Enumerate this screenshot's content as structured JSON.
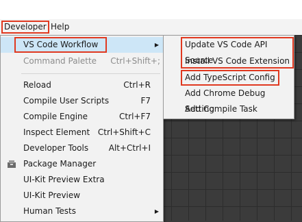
{
  "menubar": {
    "items": [
      {
        "label": "Developer"
      },
      {
        "label": "Help"
      }
    ]
  },
  "main_menu": {
    "vs_code_workflow": "VS Code Workflow",
    "command_palette": {
      "label": "Command Palette",
      "shortcut": "Ctrl+Shift+;"
    },
    "reload": {
      "label": "Reload",
      "shortcut": "Ctrl+R"
    },
    "compile_user_scripts": {
      "label": "Compile User Scripts",
      "shortcut": "F7"
    },
    "compile_engine": {
      "label": "Compile Engine",
      "shortcut": "Ctrl+F7"
    },
    "inspect_element": {
      "label": "Inspect Element",
      "shortcut": "Ctrl+Shift+C"
    },
    "developer_tools": {
      "label": "Developer Tools",
      "shortcut": "Alt+Ctrl+I"
    },
    "package_manager": {
      "label": "Package Manager"
    },
    "ui_kit_preview_extra": {
      "label": "UI-Kit Preview Extra"
    },
    "ui_kit_preview": {
      "label": "UI-Kit Preview"
    },
    "human_tests": {
      "label": "Human Tests"
    }
  },
  "submenu": {
    "update_vs_code_api_source": "Update VS Code API Source",
    "install_vs_code_extension": "Install VS Code Extension",
    "add_typescript_config": "Add TypeScript Config",
    "add_chrome_debug_setting": "Add Chrome Debug Setting",
    "add_compile_task": "Add Compile Task"
  },
  "icons": {
    "submenu_arrow": "chevron-right-icon",
    "package_manager": "package-icon"
  },
  "colors": {
    "highlight_box": "#e0381f",
    "selected_item": "#cde6f7",
    "menu_background": "#f2f2f2"
  }
}
